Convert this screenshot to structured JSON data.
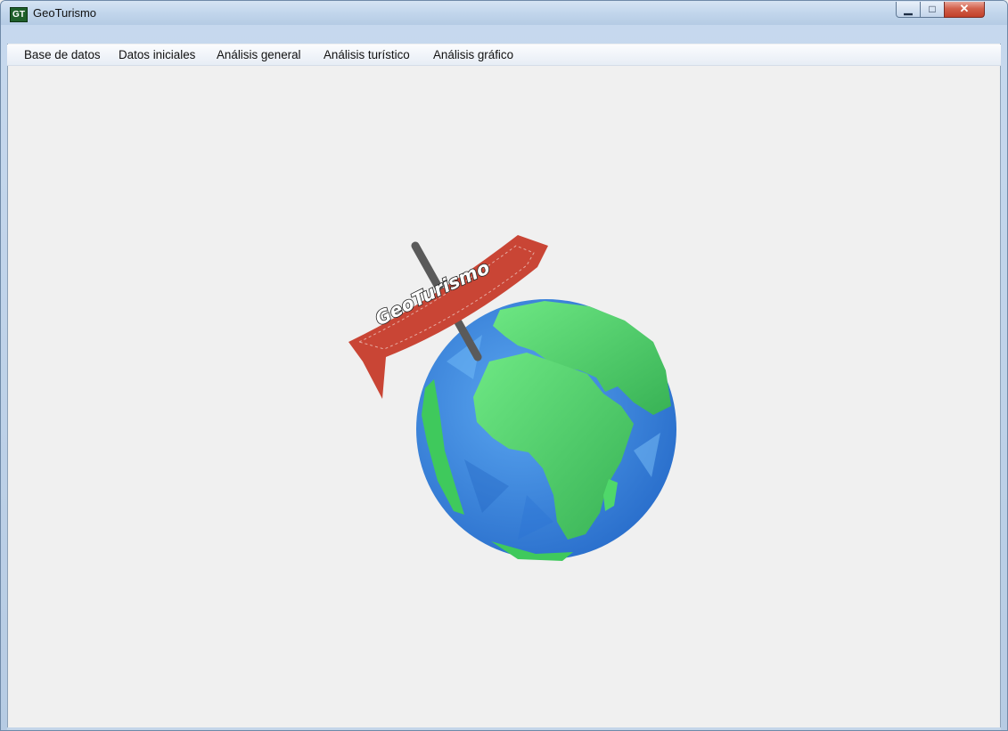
{
  "window": {
    "title": "GeoTurismo",
    "icon_text": "GT",
    "controls": {
      "minimize": "minimize-icon",
      "maximize": "maximize-icon",
      "close": "close-icon"
    }
  },
  "menu": {
    "items": [
      {
        "label": "Base de datos"
      },
      {
        "label": "Datos iniciales"
      },
      {
        "label": "Análisis general"
      },
      {
        "label": "Análisis turístico"
      },
      {
        "label": "Análisis gráfico"
      }
    ]
  },
  "logo": {
    "banner_text": "GeoTurismo"
  },
  "colors": {
    "ocean": "#3f86e0",
    "land": "#4fd86a",
    "banner": "#cf4b3c",
    "pole": "#555555"
  }
}
